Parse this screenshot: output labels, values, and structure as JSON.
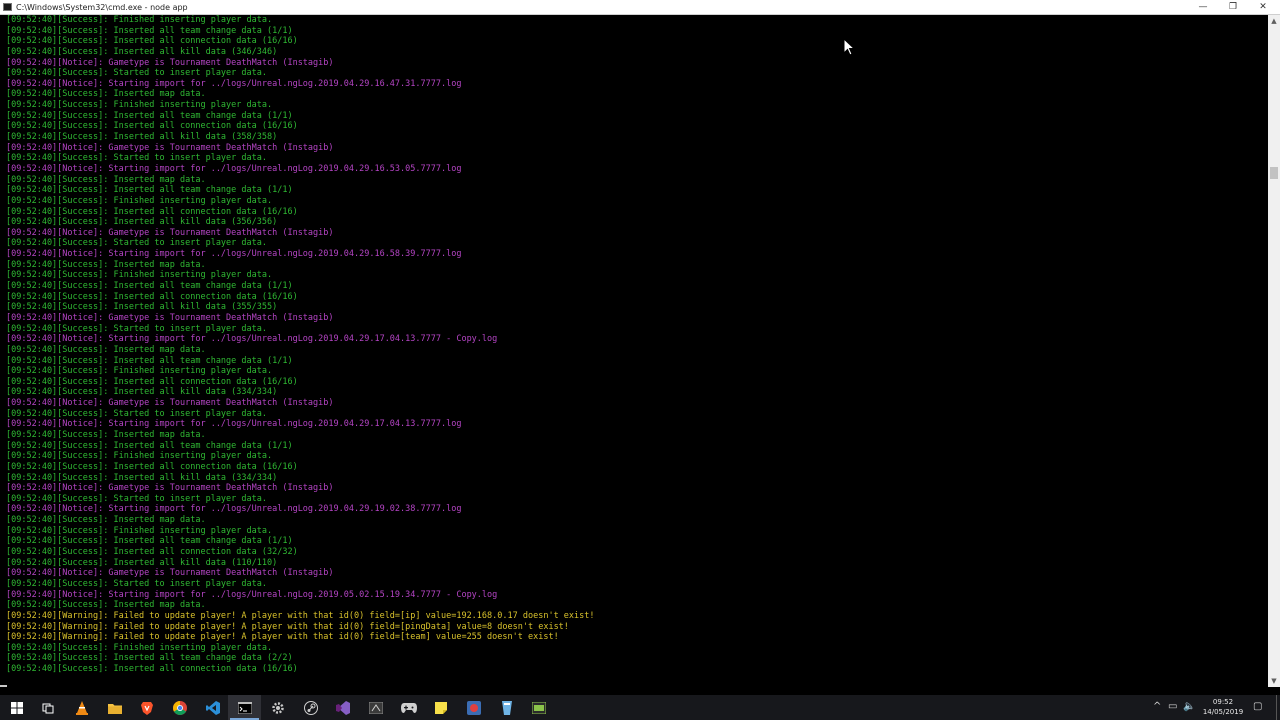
{
  "window": {
    "title": "C:\\Windows\\System32\\cmd.exe - node  app",
    "buttons": {
      "minimize": "—",
      "maximize": "❐",
      "close": "✕"
    }
  },
  "console": {
    "lines": [
      {
        "type": "success",
        "text": "[09:52:40][Success]: Finished inserting player data."
      },
      {
        "type": "success",
        "text": "[09:52:40][Success]: Inserted all team change data (1/1)"
      },
      {
        "type": "success",
        "text": "[09:52:40][Success]: Inserted all connection data (16/16)"
      },
      {
        "type": "success",
        "text": "[09:52:40][Success]: Inserted all kill data (346/346)"
      },
      {
        "type": "notice",
        "text": "[09:52:40][Notice]: Gametype is Tournament DeathMatch (Instagib)"
      },
      {
        "type": "success",
        "text": "[09:52:40][Success]: Started to insert player data."
      },
      {
        "type": "notice",
        "text": "[09:52:40][Notice]: Starting import for ../logs/Unreal.ngLog.2019.04.29.16.47.31.7777.log"
      },
      {
        "type": "success",
        "text": "[09:52:40][Success]: Inserted map data."
      },
      {
        "type": "success",
        "text": "[09:52:40][Success]: Finished inserting player data."
      },
      {
        "type": "success",
        "text": "[09:52:40][Success]: Inserted all team change data (1/1)"
      },
      {
        "type": "success",
        "text": "[09:52:40][Success]: Inserted all connection data (16/16)"
      },
      {
        "type": "success",
        "text": "[09:52:40][Success]: Inserted all kill data (358/358)"
      },
      {
        "type": "notice",
        "text": "[09:52:40][Notice]: Gametype is Tournament DeathMatch (Instagib)"
      },
      {
        "type": "success",
        "text": "[09:52:40][Success]: Started to insert player data."
      },
      {
        "type": "notice",
        "text": "[09:52:40][Notice]: Starting import for ../logs/Unreal.ngLog.2019.04.29.16.53.05.7777.log"
      },
      {
        "type": "success",
        "text": "[09:52:40][Success]: Inserted map data."
      },
      {
        "type": "success",
        "text": "[09:52:40][Success]: Inserted all team change data (1/1)"
      },
      {
        "type": "success",
        "text": "[09:52:40][Success]: Finished inserting player data."
      },
      {
        "type": "success",
        "text": "[09:52:40][Success]: Inserted all connection data (16/16)"
      },
      {
        "type": "success",
        "text": "[09:52:40][Success]: Inserted all kill data (356/356)"
      },
      {
        "type": "notice",
        "text": "[09:52:40][Notice]: Gametype is Tournament DeathMatch (Instagib)"
      },
      {
        "type": "success",
        "text": "[09:52:40][Success]: Started to insert player data."
      },
      {
        "type": "notice",
        "text": "[09:52:40][Notice]: Starting import for ../logs/Unreal.ngLog.2019.04.29.16.58.39.7777.log"
      },
      {
        "type": "success",
        "text": "[09:52:40][Success]: Inserted map data."
      },
      {
        "type": "success",
        "text": "[09:52:40][Success]: Finished inserting player data."
      },
      {
        "type": "success",
        "text": "[09:52:40][Success]: Inserted all team change data (1/1)"
      },
      {
        "type": "success",
        "text": "[09:52:40][Success]: Inserted all connection data (16/16)"
      },
      {
        "type": "success",
        "text": "[09:52:40][Success]: Inserted all kill data (355/355)"
      },
      {
        "type": "notice",
        "text": "[09:52:40][Notice]: Gametype is Tournament DeathMatch (Instagib)"
      },
      {
        "type": "success",
        "text": "[09:52:40][Success]: Started to insert player data."
      },
      {
        "type": "notice",
        "text": "[09:52:40][Notice]: Starting import for ../logs/Unreal.ngLog.2019.04.29.17.04.13.7777 - Copy.log"
      },
      {
        "type": "success",
        "text": "[09:52:40][Success]: Inserted map data."
      },
      {
        "type": "success",
        "text": "[09:52:40][Success]: Inserted all team change data (1/1)"
      },
      {
        "type": "success",
        "text": "[09:52:40][Success]: Finished inserting player data."
      },
      {
        "type": "success",
        "text": "[09:52:40][Success]: Inserted all connection data (16/16)"
      },
      {
        "type": "success",
        "text": "[09:52:40][Success]: Inserted all kill data (334/334)"
      },
      {
        "type": "notice",
        "text": "[09:52:40][Notice]: Gametype is Tournament DeathMatch (Instagib)"
      },
      {
        "type": "success",
        "text": "[09:52:40][Success]: Started to insert player data."
      },
      {
        "type": "notice",
        "text": "[09:52:40][Notice]: Starting import for ../logs/Unreal.ngLog.2019.04.29.17.04.13.7777.log"
      },
      {
        "type": "success",
        "text": "[09:52:40][Success]: Inserted map data."
      },
      {
        "type": "success",
        "text": "[09:52:40][Success]: Inserted all team change data (1/1)"
      },
      {
        "type": "success",
        "text": "[09:52:40][Success]: Finished inserting player data."
      },
      {
        "type": "success",
        "text": "[09:52:40][Success]: Inserted all connection data (16/16)"
      },
      {
        "type": "success",
        "text": "[09:52:40][Success]: Inserted all kill data (334/334)"
      },
      {
        "type": "notice",
        "text": "[09:52:40][Notice]: Gametype is Tournament DeathMatch (Instagib)"
      },
      {
        "type": "success",
        "text": "[09:52:40][Success]: Started to insert player data."
      },
      {
        "type": "notice",
        "text": "[09:52:40][Notice]: Starting import for ../logs/Unreal.ngLog.2019.04.29.19.02.38.7777.log"
      },
      {
        "type": "success",
        "text": "[09:52:40][Success]: Inserted map data."
      },
      {
        "type": "success",
        "text": "[09:52:40][Success]: Finished inserting player data."
      },
      {
        "type": "success",
        "text": "[09:52:40][Success]: Inserted all team change data (1/1)"
      },
      {
        "type": "success",
        "text": "[09:52:40][Success]: Inserted all connection data (32/32)"
      },
      {
        "type": "success",
        "text": "[09:52:40][Success]: Inserted all kill data (110/110)"
      },
      {
        "type": "notice",
        "text": "[09:52:40][Notice]: Gametype is Tournament DeathMatch (Instagib)"
      },
      {
        "type": "success",
        "text": "[09:52:40][Success]: Started to insert player data."
      },
      {
        "type": "notice",
        "text": "[09:52:40][Notice]: Starting import for ../logs/Unreal.ngLog.2019.05.02.15.19.34.7777 - Copy.log"
      },
      {
        "type": "success",
        "text": "[09:52:40][Success]: Inserted map data."
      },
      {
        "type": "warning",
        "text": "[09:52:40][Warning]: Failed to update player! A player with that id(0) field=[ip] value=192.168.0.17 doesn't exist!"
      },
      {
        "type": "warning",
        "text": "[09:52:40][Warning]: Failed to update player! A player with that id(0) field=[pingData] value=8 doesn't exist!"
      },
      {
        "type": "warning",
        "text": "[09:52:40][Warning]: Failed to update player! A player with that id(0) field=[team] value=255 doesn't exist!"
      },
      {
        "type": "success",
        "text": "[09:52:40][Success]: Finished inserting player data."
      },
      {
        "type": "success",
        "text": "[09:52:40][Success]: Inserted all team change data (2/2)"
      },
      {
        "type": "success",
        "text": "[09:52:40][Success]: Inserted all connection data (16/16)"
      }
    ]
  },
  "colors": {
    "success": "#2fb833",
    "notice": "#b444c4",
    "warning": "#d9c22c",
    "console_bg": "#000000",
    "taskbar_bg": "#17181c"
  },
  "scrollbar": {
    "up_arrow": "▲",
    "down_arrow": "▼",
    "position": 0.22
  },
  "taskbar": {
    "items": [
      {
        "name": "start-button",
        "icon": "windows-logo-icon",
        "active": false
      },
      {
        "name": "task-view-button",
        "icon": "task-view-icon",
        "active": false
      },
      {
        "name": "taskbar-vlc",
        "icon": "vlc-cone-icon",
        "active": false
      },
      {
        "name": "taskbar-file-explorer",
        "icon": "folder-icon",
        "active": false
      },
      {
        "name": "taskbar-brave",
        "icon": "brave-lion-icon",
        "active": false
      },
      {
        "name": "taskbar-chrome",
        "icon": "chrome-icon",
        "active": false
      },
      {
        "name": "taskbar-vscode",
        "icon": "vscode-icon",
        "active": false
      },
      {
        "name": "taskbar-cmd",
        "icon": "terminal-icon",
        "active": true
      },
      {
        "name": "taskbar-gear-app",
        "icon": "gear-icon",
        "active": false
      },
      {
        "name": "taskbar-steam",
        "icon": "steam-icon",
        "active": false
      },
      {
        "name": "taskbar-visual-studio",
        "icon": "visual-studio-icon",
        "active": false
      },
      {
        "name": "taskbar-app-dark",
        "icon": "dark-app-icon",
        "active": false
      },
      {
        "name": "taskbar-gamepad",
        "icon": "gamepad-icon",
        "active": false
      },
      {
        "name": "taskbar-sticky-notes",
        "icon": "sticky-note-icon",
        "active": false
      },
      {
        "name": "taskbar-app-red",
        "icon": "red-app-icon",
        "active": false
      },
      {
        "name": "taskbar-app-blue",
        "icon": "blue-app-icon",
        "active": false
      },
      {
        "name": "taskbar-app-green",
        "icon": "green-app-icon",
        "active": false
      }
    ],
    "tray": {
      "chevron": "^",
      "network": "▭",
      "volume": "🔈",
      "notifications": "▢"
    },
    "clock": {
      "time": "09:52",
      "date": "14/05/2019"
    }
  }
}
